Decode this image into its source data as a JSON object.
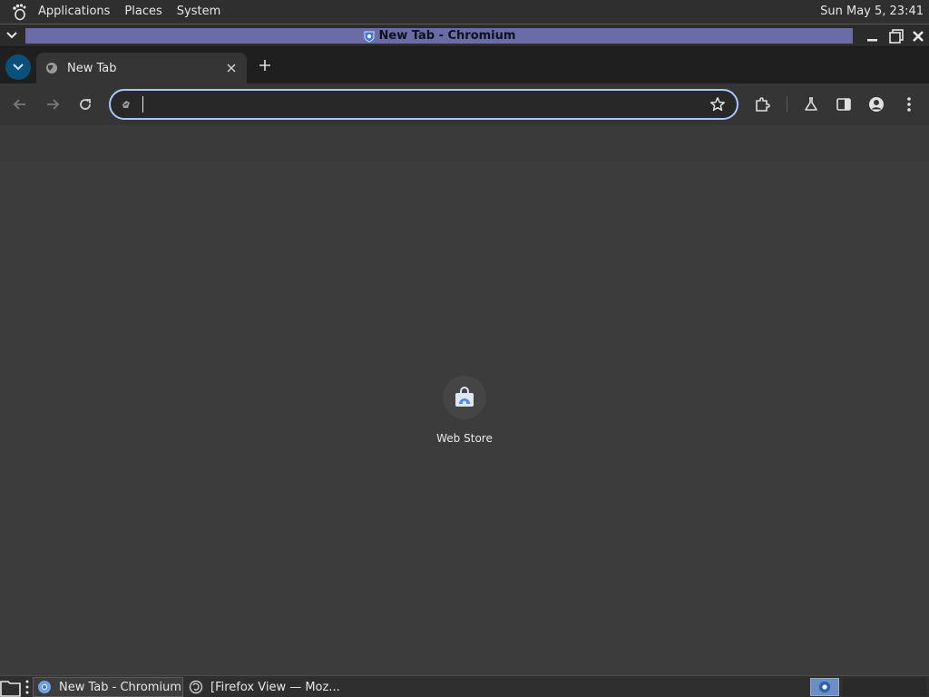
{
  "top_panel": {
    "menus": [
      "Applications",
      "Places",
      "System"
    ],
    "clock": "Sun May  5, 23:41"
  },
  "window": {
    "title": "New Tab - Chromium"
  },
  "browser": {
    "tab_label": "New Tab",
    "omnibox_value": "",
    "shortcuts": [
      {
        "label": "Web Store"
      }
    ]
  },
  "taskbar": {
    "tasks": [
      "New Tab - Chromium",
      "[Firefox View — Moz..."
    ]
  },
  "colors": {
    "title_highlight": "#6b6ba6",
    "omnibox_focus": "#a8c7fa",
    "background": "#3c3c3c"
  }
}
